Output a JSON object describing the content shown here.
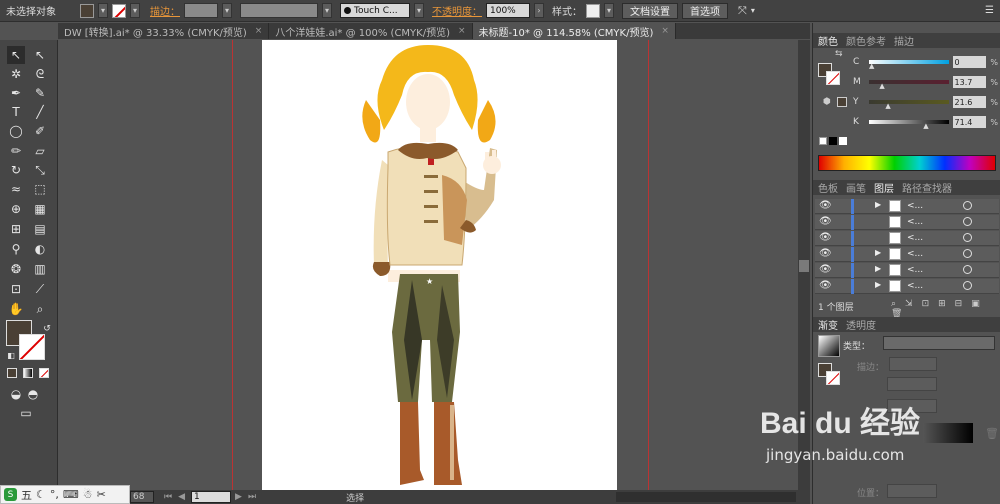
{
  "control": {
    "selection_status": "未选择对象",
    "stroke_label": "描边：",
    "brush_name": "Touch C...",
    "opacity_label": "不透明度：",
    "opacity_value": "100%",
    "style_label": "样式：",
    "doc_settings": "文档设置",
    "preferences": "首选项"
  },
  "tabs": [
    {
      "label": "DW [转换].ai* @ 33.33% (CMYK/预览)"
    },
    {
      "label": "八个洋娃娃.ai* @ 100% (CMYK/预览)"
    },
    {
      "label": "未标题-10* @ 114.58% (CMYK/预览)"
    }
  ],
  "color_panel": {
    "tabs": [
      "颜色",
      "颜色参考",
      "描边"
    ],
    "sliders": [
      {
        "letter": "C",
        "value": "0",
        "pct": 0.0,
        "from": "#ffffff",
        "to": "#00a0e0"
      },
      {
        "letter": "M",
        "value": "13.7",
        "pct": 13.7,
        "from": "#3a3030",
        "to": "#5a2030"
      },
      {
        "letter": "Y",
        "value": "21.6",
        "pct": 21.6,
        "from": "#3a3a30",
        "to": "#5a5a20"
      },
      {
        "letter": "K",
        "value": "71.4",
        "pct": 71.4,
        "from": "#ffffff",
        "to": "#000000"
      }
    ],
    "percent_sign": "%"
  },
  "layers_panel": {
    "tabs": [
      "色板",
      "画笔",
      "图层",
      "路径查找器"
    ],
    "rows": [
      {
        "name": "<..."
      },
      {
        "name": "<..."
      },
      {
        "name": "<..."
      },
      {
        "name": "<..."
      },
      {
        "name": "<..."
      },
      {
        "name": "<..."
      }
    ],
    "count": "1 个图层"
  },
  "gradient_panel": {
    "tabs": [
      "渐变",
      "透明度"
    ],
    "type_label": "类型：",
    "stroke_label": "描边：",
    "position_label": "位置："
  },
  "status": {
    "zoom": "68",
    "page": "1",
    "mode": "选择"
  },
  "ime": {
    "label": "五"
  },
  "watermark": {
    "text": "Bai du 经验",
    "url": "jingyan.baidu.com"
  },
  "colors": {
    "fill": "#4a4035",
    "accent_orange": "#e8963a",
    "guide_red": "#b33333"
  }
}
